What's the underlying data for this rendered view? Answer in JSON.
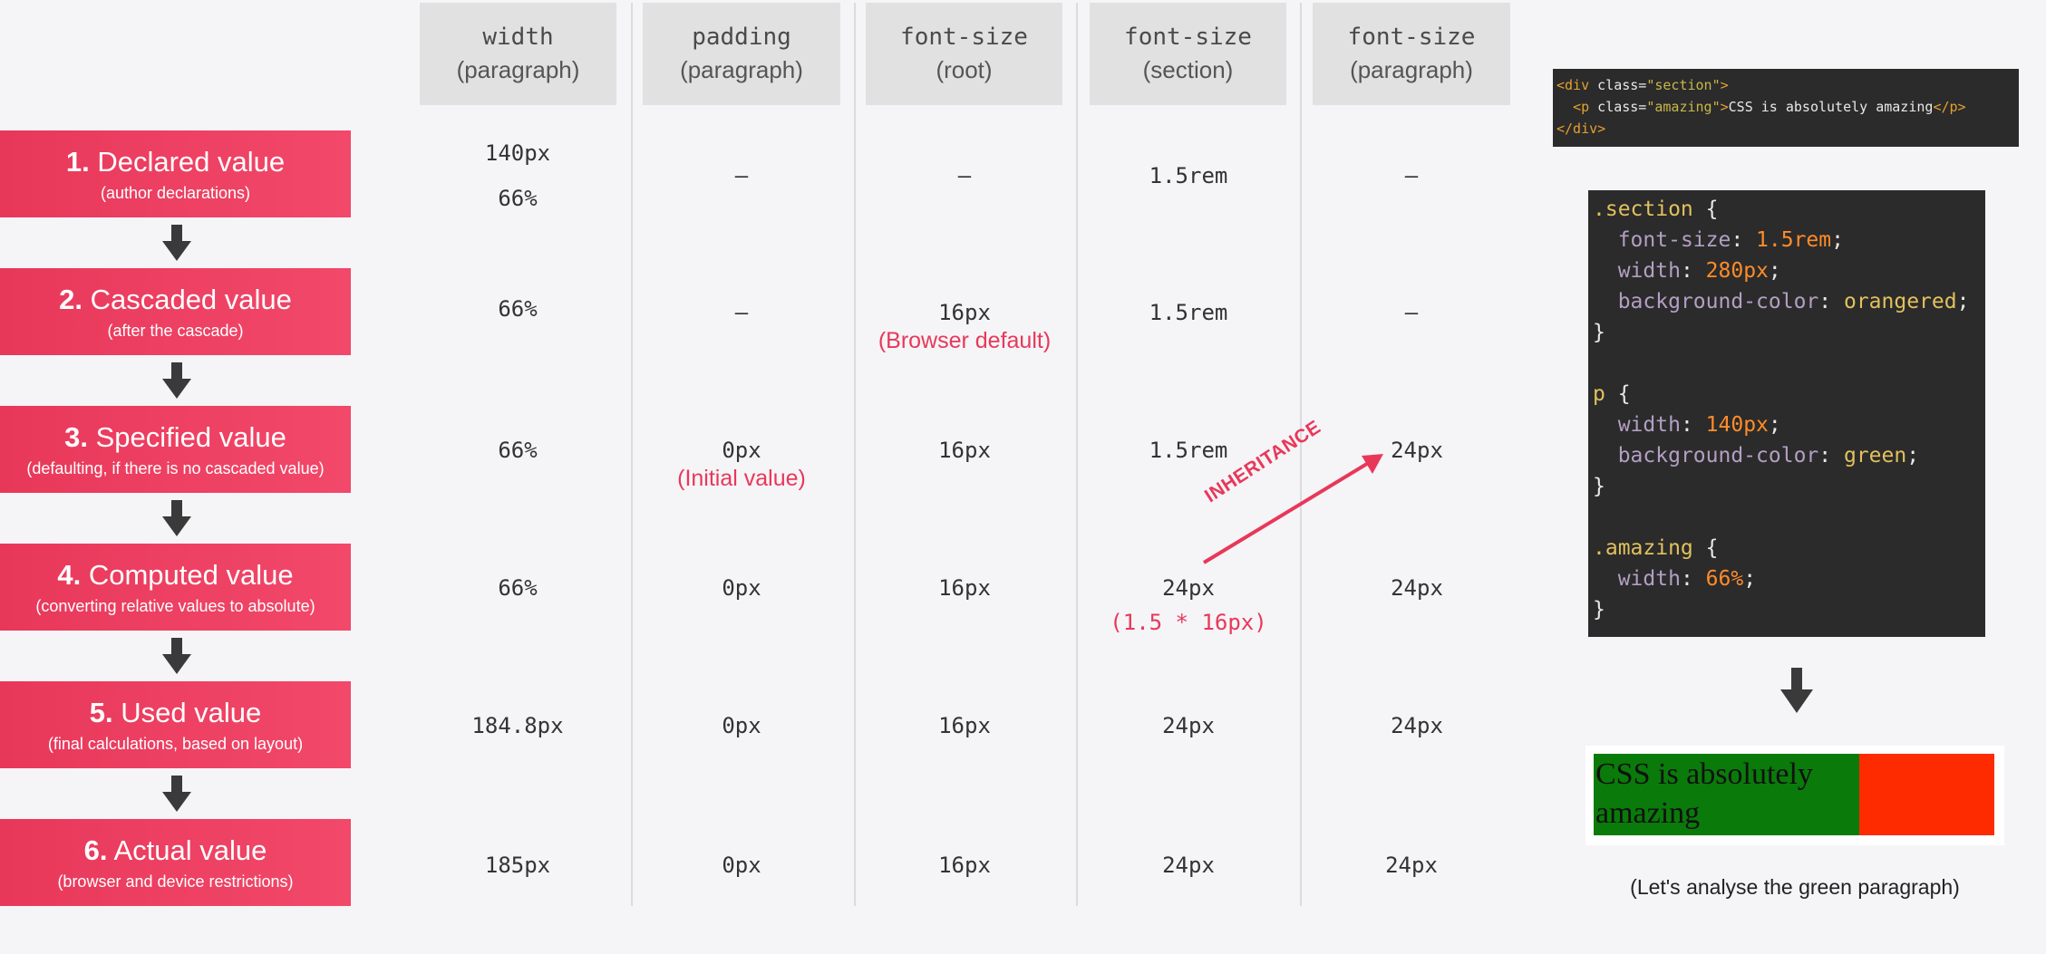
{
  "columns": [
    {
      "prop": "width",
      "context": "(paragraph)"
    },
    {
      "prop": "padding",
      "context": "(paragraph)"
    },
    {
      "prop": "font-size",
      "context": "(root)"
    },
    {
      "prop": "font-size",
      "context": "(section)"
    },
    {
      "prop": "font-size",
      "context": "(paragraph)"
    }
  ],
  "stages": [
    {
      "num": "1.",
      "label": "Declared value",
      "sub": "(author declarations)"
    },
    {
      "num": "2.",
      "label": "Cascaded value",
      "sub": "(after the cascade)"
    },
    {
      "num": "3.",
      "label": "Specified value",
      "sub": "(defaulting, if there is no cascaded value)"
    },
    {
      "num": "4.",
      "label": "Computed value",
      "sub": "(converting relative values to absolute)"
    },
    {
      "num": "5.",
      "label": "Used value",
      "sub": "(final calculations, based on layout)"
    },
    {
      "num": "6.",
      "label": "Actual value",
      "sub": "(browser and device restrictions)"
    }
  ],
  "cells": {
    "r1": {
      "c1a": "140px",
      "c1b": "66%",
      "c2": "–",
      "c3": "–",
      "c4": "1.5rem",
      "c5": "–"
    },
    "r2": {
      "c1": "66%",
      "c2": "–",
      "c3": "16px",
      "c3note": "(Browser default)",
      "c4": "1.5rem",
      "c5": "–"
    },
    "r3": {
      "c1": "66%",
      "c2": "0px",
      "c2note": "(Initial value)",
      "c3": "16px",
      "c4": "1.5rem",
      "c5": "24px"
    },
    "r4": {
      "c1": "66%",
      "c2": "0px",
      "c3": "16px",
      "c4": "24px",
      "c4note": "(1.5 * 16px)",
      "c5": "24px"
    },
    "r5": {
      "c1": "184.8px",
      "c2": "0px",
      "c3": "16px",
      "c4": "24px",
      "c5": "24px"
    },
    "r6": {
      "c1": "185px",
      "c2": "0px",
      "c3": "16px",
      "c4": "24px",
      "c5": "24px"
    }
  },
  "inheritance_label": "INHERITANCE",
  "html_code": {
    "l1_open": "<div ",
    "l1_attr": "class=",
    "l1_str": "\"section\"",
    "l1_close": ">",
    "l2_indent": "  ",
    "l2_open": "<p ",
    "l2_attr": "class=",
    "l2_str": "\"amazing\"",
    "l2_close": ">",
    "l2_text": "CSS is absolutely amazing",
    "l2_end": "</p>",
    "l3": "</div>"
  },
  "css_code": {
    "s1": ".section",
    "brace_open": " {",
    "brace_close": "}",
    "s1p1": "font-size",
    "s1v1": "1.5rem",
    "s1p2": "width",
    "s1v2": "280px",
    "s1p3": "background-color",
    "s1v3": "orangered",
    "s2": "p",
    "s2p1": "width",
    "s2v1": "140px",
    "s2p2": "background-color",
    "s2v2": "green",
    "s3": ".amazing",
    "s3p1": "width",
    "s3v1": "66%"
  },
  "result_text": "CSS is absolutely amazing",
  "caption": "(Let's analyse the green paragraph)",
  "colors": {
    "stage": "#e8385a",
    "accent_red": "#e8385a",
    "green": "#0a7a0a",
    "orangered": "#ff2b00"
  }
}
